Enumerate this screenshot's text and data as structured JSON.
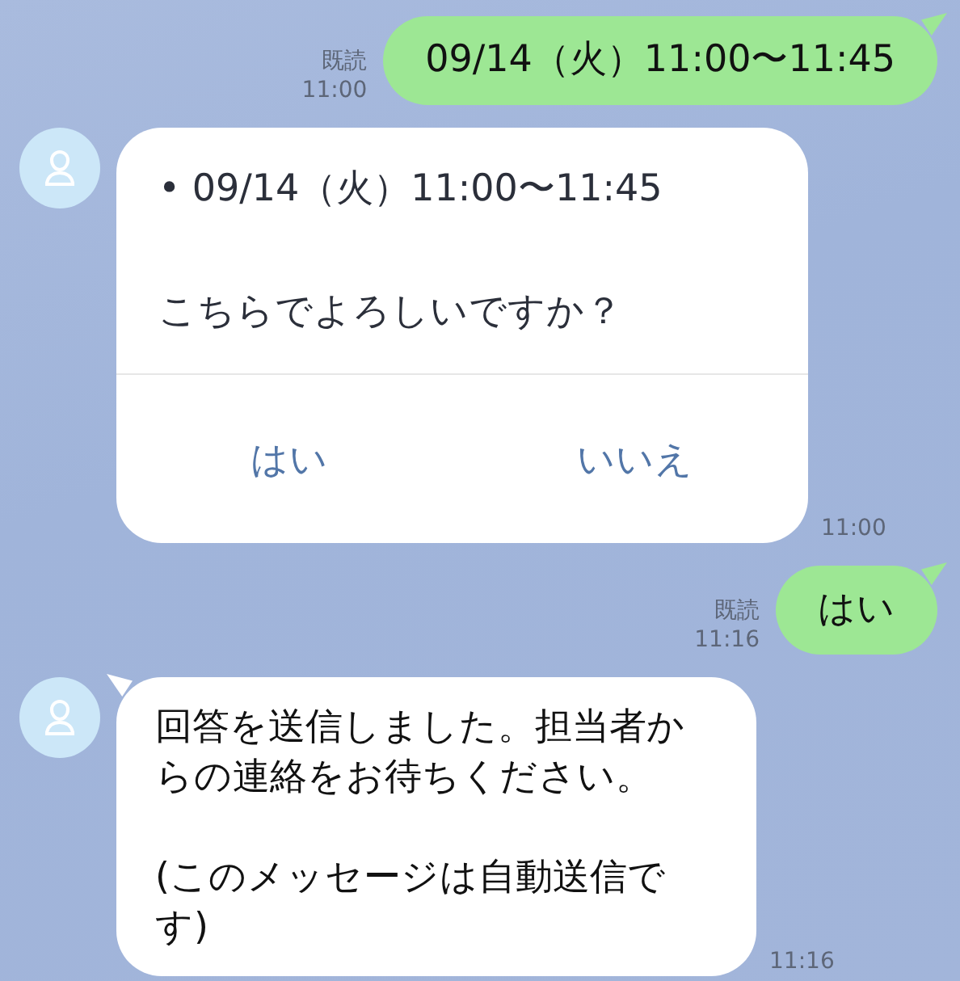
{
  "messages": [
    {
      "kind": "sent",
      "text": "09/14（火）11:00〜11:45",
      "read": "既読",
      "time": "11:00"
    },
    {
      "kind": "confirm",
      "bullet": "•",
      "text": "09/14（火）11:00〜11:45",
      "question": "こちらでよろしいですか？",
      "buttons": [
        "はい",
        "いいえ"
      ],
      "time": "11:00"
    },
    {
      "kind": "sent",
      "text": "はい",
      "read": "既読",
      "time": "11:16"
    },
    {
      "kind": "received",
      "text": "回答を送信しました。担当者からの連絡をお待ちください。\n\n(このメッセージは自動送信です)",
      "time": "11:16"
    }
  ]
}
